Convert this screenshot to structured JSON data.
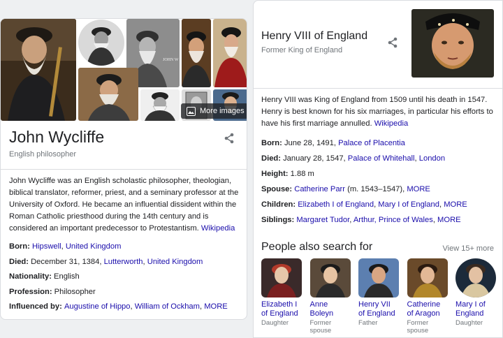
{
  "left_card": {
    "more_images_label": "More images",
    "title": "John Wycliffe",
    "subtitle": "English philosopher",
    "description": "John Wycliffe was an English scholastic philosopher, theologian, biblical translator, reformer, priest, and a seminary professor at the University of Oxford. He became an influential dissident within the Roman Catholic priesthood during the 14th century and is considered an important predecessor to Protestantism.",
    "wiki_link": "Wikipedia",
    "image_inline_text": "JOHN W",
    "facts": [
      {
        "label": "Born:",
        "parts": [
          {
            "text": "Hipswell",
            "link": true
          },
          {
            "text": ", ",
            "link": false
          },
          {
            "text": "United Kingdom",
            "link": true
          }
        ]
      },
      {
        "label": "Died:",
        "parts": [
          {
            "text": "December 31, 1384, ",
            "link": false
          },
          {
            "text": "Lutterworth",
            "link": true
          },
          {
            "text": ", ",
            "link": false
          },
          {
            "text": "United Kingdom",
            "link": true
          }
        ]
      },
      {
        "label": "Nationality:",
        "parts": [
          {
            "text": "English",
            "link": false
          }
        ]
      },
      {
        "label": "Profession:",
        "parts": [
          {
            "text": "Philosopher",
            "link": false
          }
        ]
      },
      {
        "label": "Influenced by:",
        "parts": [
          {
            "text": "Augustine of Hippo",
            "link": true
          },
          {
            "text": ", ",
            "link": false
          },
          {
            "text": "William of Ockham",
            "link": true
          },
          {
            "text": ", ",
            "link": false
          },
          {
            "text": "MORE",
            "link": true
          }
        ]
      }
    ]
  },
  "right_card": {
    "title": "Henry VIII of England",
    "subtitle": "Former King of England",
    "description": "Henry VIII was King of England from 1509 until his death in 1547. Henry is best known for his six marriages, in particular his efforts to have his first marriage annulled.",
    "wiki_link": "Wikipedia",
    "facts": [
      {
        "label": "Born:",
        "parts": [
          {
            "text": "June 28, 1491, ",
            "link": false
          },
          {
            "text": "Palace of Placentia",
            "link": true
          }
        ]
      },
      {
        "label": "Died:",
        "parts": [
          {
            "text": "January 28, 1547, ",
            "link": false
          },
          {
            "text": "Palace of Whitehall",
            "link": true
          },
          {
            "text": ", ",
            "link": false
          },
          {
            "text": "London",
            "link": true
          }
        ]
      },
      {
        "label": "Height:",
        "parts": [
          {
            "text": "1.88 m",
            "link": false
          }
        ]
      },
      {
        "label": "Spouse:",
        "parts": [
          {
            "text": "Catherine Parr",
            "link": true
          },
          {
            "text": " (m. 1543–1547), ",
            "link": false
          },
          {
            "text": "MORE",
            "link": true
          }
        ]
      },
      {
        "label": "Children:",
        "parts": [
          {
            "text": "Elizabeth I of England",
            "link": true
          },
          {
            "text": ", ",
            "link": false
          },
          {
            "text": "Mary I of England",
            "link": true
          },
          {
            "text": ", ",
            "link": false
          },
          {
            "text": "MORE",
            "link": true
          }
        ]
      },
      {
        "label": "Siblings:",
        "parts": [
          {
            "text": "Margaret Tudor",
            "link": true
          },
          {
            "text": ", ",
            "link": false
          },
          {
            "text": "Arthur, Prince of Wales",
            "link": true
          },
          {
            "text": ", ",
            "link": false
          },
          {
            "text": "MORE",
            "link": true
          }
        ]
      }
    ],
    "people_also_search_title": "People also search for",
    "view_more": "View 15+ more",
    "people": [
      {
        "name_line1": "Elizabeth I",
        "name_line2": "of England",
        "relation_line1": "Daughter",
        "relation_line2": ""
      },
      {
        "name_line1": "Anne",
        "name_line2": "Boleyn",
        "relation_line1": "Former",
        "relation_line2": "spouse"
      },
      {
        "name_line1": "Henry VII",
        "name_line2": "of England",
        "relation_line1": "Father",
        "relation_line2": ""
      },
      {
        "name_line1": "Catherine",
        "name_line2": "of Aragon",
        "relation_line1": "Former",
        "relation_line2": "spouse"
      },
      {
        "name_line1": "Mary I of",
        "name_line2": "England",
        "relation_line1": "Daughter",
        "relation_line2": ""
      }
    ]
  },
  "colors": {
    "link": "#1a0dab",
    "text": "#202124",
    "muted": "#70757a",
    "border": "#dadce0"
  },
  "icons": [
    "share-icon",
    "images-icon"
  ]
}
